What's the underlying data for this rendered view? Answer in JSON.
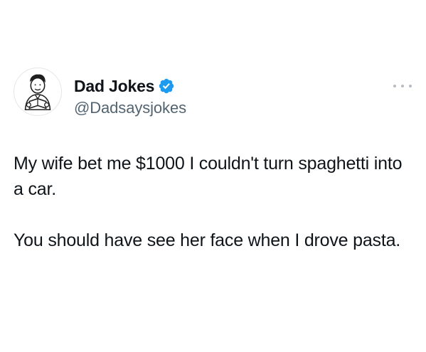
{
  "author": {
    "display_name": "Dad Jokes",
    "handle": "@Dadsaysjokes",
    "verified": true,
    "avatar_icon": "cartoon-dad-holding-book-avatar"
  },
  "tweet": {
    "paragraphs": [
      "My wife bet me $1000 I couldn't turn spaghetti into a car.",
      "You should have see her face when I drove pasta."
    ]
  },
  "icons": {
    "verified": "verified-badge-icon",
    "more": "more-options-icon"
  },
  "colors": {
    "verified_blue": "#1d9bf0",
    "text": "#0f1419",
    "secondary_text": "#536471",
    "more_dots": "#b5bcc2"
  }
}
